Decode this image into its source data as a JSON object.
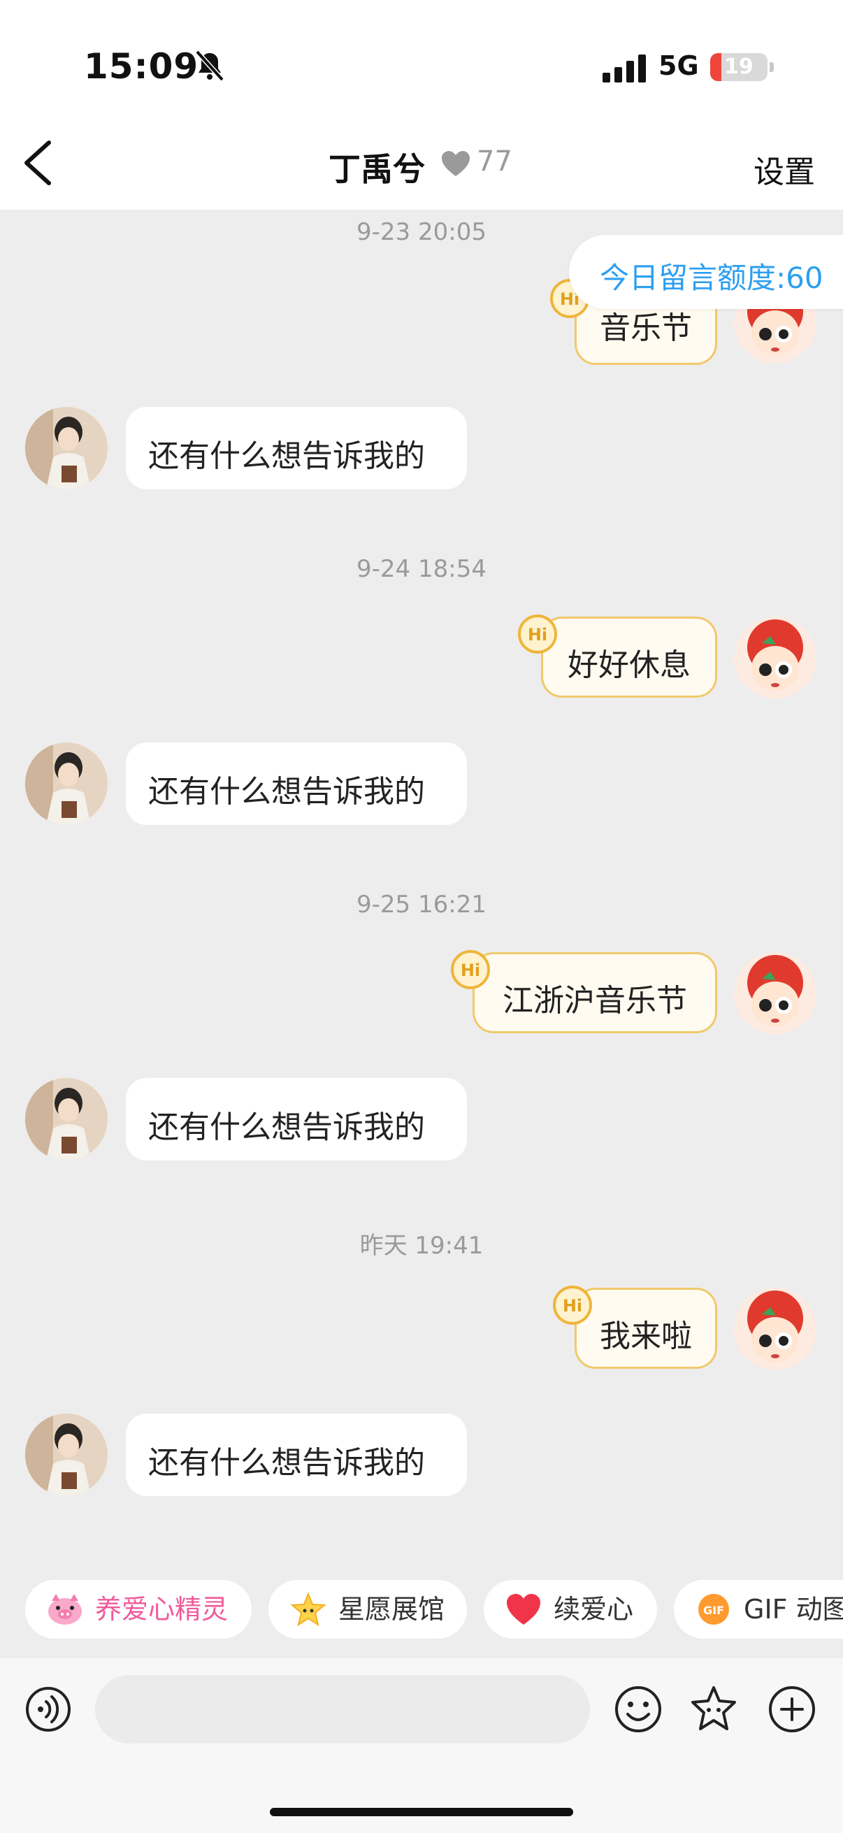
{
  "status_bar": {
    "time": "15:09",
    "network": "5G",
    "battery_level": "19",
    "battery_fraction": 0.19
  },
  "header": {
    "title": "丁禹兮",
    "intimacy": "77",
    "settings_label": "设置"
  },
  "quota_label": "今日留言额度:60",
  "conversation": [
    {
      "time": "9-23 20:05",
      "sent": "音乐节",
      "reply": "还有什么想告诉我的"
    },
    {
      "time": "9-24 18:54",
      "sent": "好好休息",
      "reply": "还有什么想告诉我的"
    },
    {
      "time": "9-25 16:21",
      "sent": "江浙沪音乐节",
      "reply": "还有什么想告诉我的"
    },
    {
      "time": "昨天 19:41",
      "sent": "我来啦",
      "reply": "还有什么想告诉我的"
    }
  ],
  "badge_text": "Hi",
  "quick_actions": [
    {
      "label": "养爱心精灵",
      "icon": "pig-sprite-icon",
      "color": "#f05a9c"
    },
    {
      "label": "星愿展馆",
      "icon": "star-icon",
      "color": "#333333"
    },
    {
      "label": "续爱心",
      "icon": "heart-icon",
      "color": "#333333"
    },
    {
      "label": "GIF 动图",
      "icon": "gif-icon",
      "color": "#333333"
    }
  ],
  "gif_badge": "GIF",
  "colors": {
    "quota_blue": "#2d9ff0",
    "bubble_border": "#f0c96b",
    "pink": "#f05a9c"
  }
}
